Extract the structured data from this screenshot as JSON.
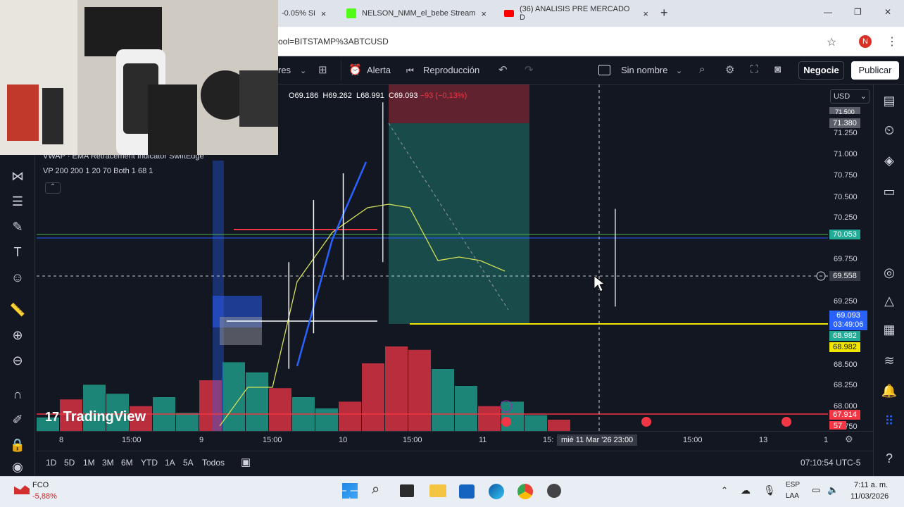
{
  "browser": {
    "tabs": [
      {
        "title": "-0.05% Si",
        "close": "×"
      },
      {
        "title": "NELSON_NMM_el_bebe Stream",
        "close": "×"
      },
      {
        "title": "(36) ANALISIS PRE MERCADO D",
        "close": "×"
      }
    ],
    "new_tab": "+",
    "url": "ool=BITSTAMP%3ABTCUSD",
    "profile_initial": "N",
    "window_controls": {
      "min": "—",
      "max": "❐",
      "close": "✕"
    }
  },
  "toolbar": {
    "indicators_fragment": "res",
    "alert": "Alerta",
    "replay": "Reproducción",
    "layout_name": "Sin nombre",
    "trade": "Negocie",
    "publish": "Publicar"
  },
  "chart": {
    "ohlc": {
      "o": "O69.186",
      "h": "H69.262",
      "l": "L68.991",
      "c": "C69.093",
      "chg": "−93 (−0,13%)"
    },
    "indicator1": "VWAP · EMA Retracement Indicator SwiftEdge",
    "indicator2": "VP 200 200 1 20 70 Both 1 68 1",
    "currency": "USD",
    "watermark": "TradingView",
    "crosshair_time": "mié 11 Mar '26   23:00"
  },
  "price_axis": {
    "ticks": [
      "71.250",
      "71.000",
      "70.750",
      "70.500",
      "70.250",
      "69.750",
      "69.250",
      "68.500",
      "68.250",
      "68.000",
      "67.750"
    ],
    "labels": {
      "top_clip": "71.500",
      "l71380": "71.380",
      "l70053": "70.053",
      "cursor": "69.558",
      "last": "69.093",
      "countdown": "03:49:06",
      "l68982a": "68.982",
      "l68982b": "68.982",
      "l67914": "67.914",
      "l57": "57"
    },
    "colors": {
      "green": "#22ab94",
      "red": "#f23645",
      "blue": "#2962ff",
      "yellow": "#f2e600",
      "gray": "#5d606b"
    }
  },
  "time_axis": {
    "ticks": [
      "8",
      "15:00",
      "9",
      "15:00",
      "10",
      "15:00",
      "11",
      "15:",
      "15:00",
      "13",
      "1"
    ]
  },
  "ranges": [
    "1D",
    "5D",
    "1M",
    "3M",
    "6M",
    "YTD",
    "1A",
    "5A",
    "Todos"
  ],
  "clock": "07:10:54 UTC-5",
  "taskbar": {
    "ticker": "FCO",
    "ticker_change": "-5,88%",
    "lang1": "ESP",
    "lang2": "LAA",
    "time": "7:11 a. m.",
    "date": "11/03/2026"
  },
  "chart_data": {
    "type": "candlestick",
    "ylim": [
      67.7,
      71.6
    ],
    "x": [
      "8",
      "15:00",
      "9",
      "15:00",
      "10",
      "15:00",
      "11"
    ],
    "candles_hl": [
      {
        "x": 0.51,
        "h": 69.6,
        "l": 68.4,
        "up": true
      },
      {
        "x": 0.56,
        "h": 70.3,
        "l": 68.8,
        "up": true
      },
      {
        "x": 0.62,
        "h": 70.6,
        "l": 69.4,
        "up": true
      },
      {
        "x": 0.7,
        "h": 71.4,
        "l": 69.6,
        "up": false
      },
      {
        "x": 1.17,
        "h": 70.2,
        "l": 69.1,
        "up": false
      }
    ],
    "volume": [
      12,
      28,
      41,
      33,
      22,
      30,
      16,
      45,
      61,
      52,
      38,
      30,
      20,
      26,
      60,
      75,
      72,
      55,
      40,
      22,
      26,
      14,
      10
    ]
  }
}
